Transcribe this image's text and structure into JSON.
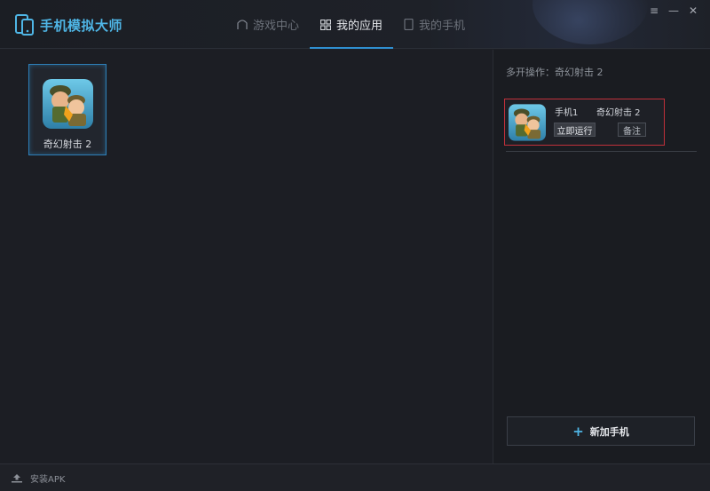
{
  "app": {
    "title": "手机模拟大师",
    "accent": "#2f8fd0",
    "logo_color": "#4fb6e6"
  },
  "nav": {
    "tabs": [
      {
        "label": "游戏中心",
        "icon": "home-icon",
        "active": false
      },
      {
        "label": "我的应用",
        "icon": "grid-icon",
        "active": true
      },
      {
        "label": "我的手机",
        "icon": "phone-icon",
        "active": false
      }
    ]
  },
  "window_controls": {
    "menu": "≡",
    "minimize": "—",
    "close": "✕"
  },
  "my_apps": [
    {
      "name": "奇幻射击 2",
      "icon": "game-soldier-icon",
      "selected": true
    }
  ],
  "multi_open": {
    "title": "多开操作：奇幻射击 2",
    "phones": [
      {
        "name": "手机1",
        "app": "奇幻射击 2",
        "run_label": "立即运行",
        "note_label": "备注",
        "highlight_color": "#c0303a"
      }
    ],
    "add_phone_label": "新加手机",
    "add_phone_icon": "+"
  },
  "statusbar": {
    "install_label": "安装APK",
    "install_icon": "upload-icon"
  }
}
